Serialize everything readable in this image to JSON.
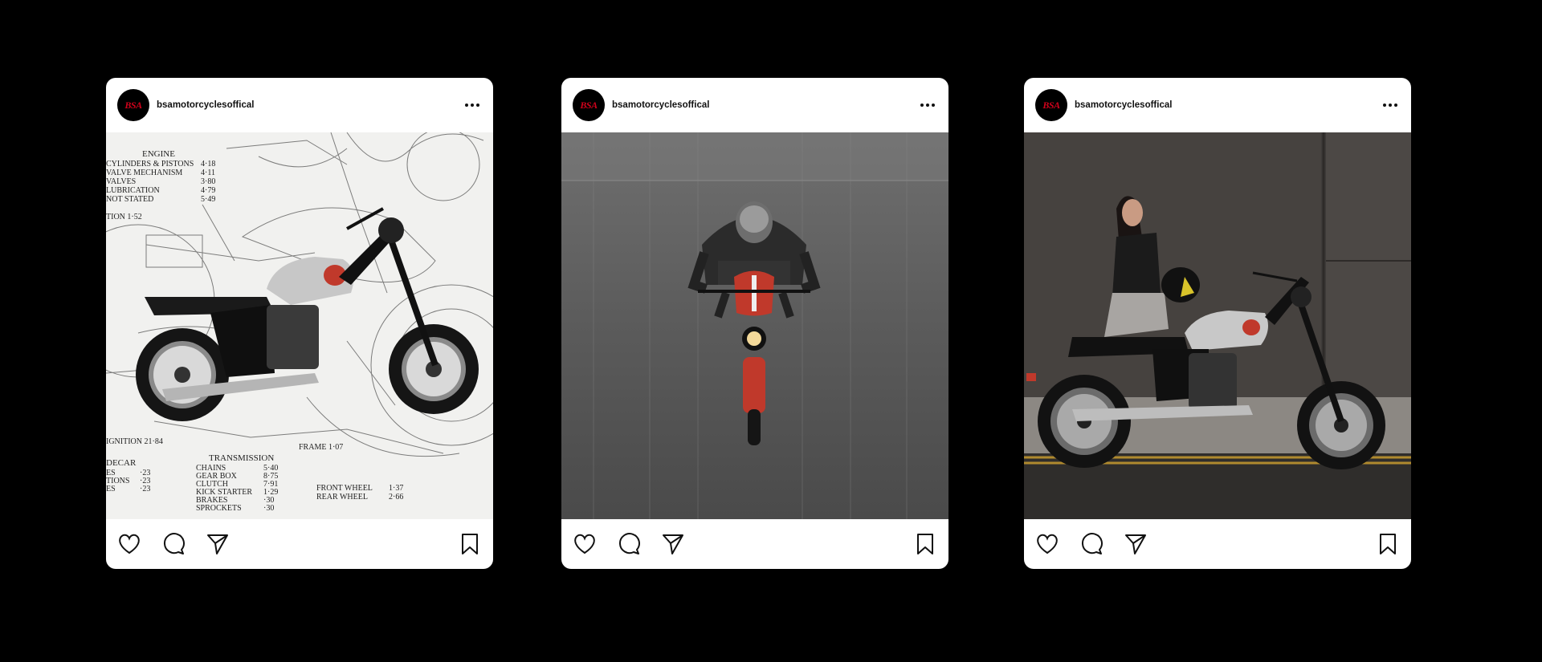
{
  "posts": [
    {
      "username": "bsamotorcyclesoffical",
      "avatar_text": "BSA",
      "image": "motorcycle-over-technical-drawing",
      "drawing_labels": {
        "engine": "ENGINE",
        "engine_lines": [
          "CYLINDERS & PISTONS",
          "VALVE MECHANISM",
          "VALVES",
          "LUBRICATION",
          "NOT STATED"
        ],
        "engine_values": [
          "4·18",
          "4·11",
          "3·80",
          "4·79",
          "5·49"
        ],
        "tion": "TION    1·52",
        "ignition": "IGNITION     21·84",
        "frame": "FRAME    1·07",
        "decar": "DECAR",
        "decar_lines": [
          "ES",
          "TIONS",
          "ES"
        ],
        "decar_values": [
          "·23",
          "·23",
          "·23"
        ],
        "transmission": "TRANSMISSION",
        "trans_lines": [
          "CHAINS",
          "GEAR BOX",
          "CLUTCH",
          "KICK STARTER",
          "BRAKES",
          "SPROCKETS"
        ],
        "trans_values": [
          "5·40",
          "8·75",
          "7·91",
          "1·29",
          "·30",
          "·30"
        ],
        "front_wheel": "FRONT WHEEL",
        "rear_wheel": "REAR WHEEL",
        "front_wheel_value": "1·37",
        "rear_wheel_value": "2·66"
      }
    },
    {
      "username": "bsamotorcyclesoffical",
      "avatar_text": "BSA",
      "image": "rider-top-down-on-road"
    },
    {
      "username": "bsamotorcyclesoffical",
      "avatar_text": "BSA",
      "image": "woman-with-helmet-beside-motorcycle"
    }
  ],
  "icons": {
    "more": "more-options-icon",
    "like": "heart-icon",
    "comment": "comment-icon",
    "share": "send-icon",
    "save": "bookmark-icon"
  },
  "colors": {
    "background": "#000000",
    "card": "#ffffff",
    "brand_red": "#d0021b"
  }
}
